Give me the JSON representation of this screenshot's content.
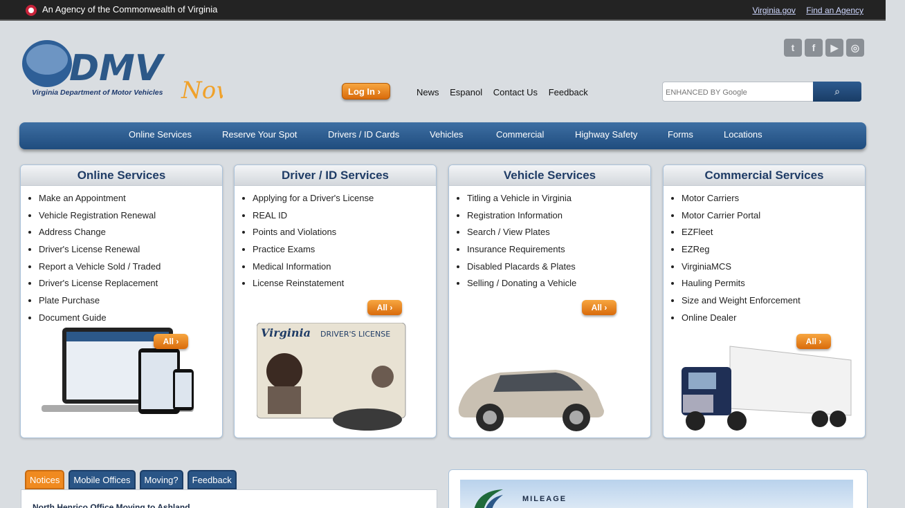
{
  "topbar": {
    "agency_text": "An Agency of the Commonwealth of Virginia",
    "links": [
      "Virginia.gov",
      "Find an Agency"
    ]
  },
  "header": {
    "logo_subtitle": "Virginia Department of Motor Vehicles",
    "logo_word": "Now",
    "login_label": "Log In",
    "util_links": [
      "News",
      "Espanol",
      "Contact Us",
      "Feedback"
    ],
    "search_placeholder": "ENHANCED BY Google",
    "social": [
      "twitter-icon",
      "facebook-icon",
      "youtube-icon",
      "instagram-icon"
    ]
  },
  "mainnav": {
    "items": [
      "Online Services",
      "Reserve Your Spot",
      "Drivers / ID Cards",
      "Vehicles",
      "Commercial",
      "Highway Safety",
      "Forms",
      "Locations"
    ]
  },
  "panels": [
    {
      "title": "Online Services",
      "items": [
        "Make an Appointment",
        "Vehicle Registration Renewal",
        "Address Change",
        "Driver's License Renewal",
        "Report a Vehicle Sold / Traded",
        "Driver's License Replacement",
        "Plate Purchase",
        "Document Guide"
      ],
      "all_label": "All"
    },
    {
      "title": "Driver / ID Services",
      "items": [
        "Applying for a Driver's License",
        "REAL ID",
        "Points and Violations",
        "Practice Exams",
        "Medical Information",
        "License Reinstatement"
      ],
      "all_label": "All"
    },
    {
      "title": "Vehicle Services",
      "items": [
        "Titling a Vehicle in Virginia",
        "Registration Information",
        "Search / View Plates",
        "Insurance Requirements",
        "Disabled Placards & Plates",
        "Selling / Donating a Vehicle"
      ],
      "all_label": "All"
    },
    {
      "title": "Commercial Services",
      "items": [
        "Motor Carriers",
        "Motor Carrier Portal",
        "EZFleet",
        "EZReg",
        "VirginiaMCS",
        "Hauling Permits",
        "Size and Weight Enforcement",
        "Online Dealer"
      ],
      "all_label": "All"
    }
  ],
  "tabs": [
    "Notices",
    "Mobile Offices",
    "Moving?",
    "Feedback"
  ],
  "notice_title": "North Henrico Office Moving to Ashland",
  "promo_text": "MILEAGE",
  "license_card": {
    "state": "Virginia",
    "type": "DRIVER'S LICENSE"
  }
}
